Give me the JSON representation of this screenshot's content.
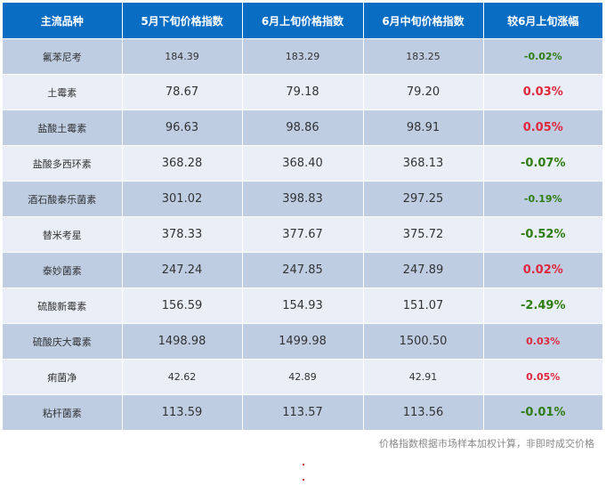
{
  "headers": [
    "主流品种",
    "5月下旬价格指数",
    "6月上旬价格指数",
    "6月中旬价格指数",
    "较6月上旬涨幅"
  ],
  "rows": [
    {
      "name": "氟苯尼考",
      "v1": "184.39",
      "v2": "183.29",
      "v3": "183.25",
      "change": "-0.02%",
      "dir": "down"
    },
    {
      "name": "土霉素",
      "v1": "78.67",
      "v2": "79.18",
      "v3": "79.20",
      "change": "0.03%",
      "dir": "up"
    },
    {
      "name": "盐酸土霉素",
      "v1": "96.63",
      "v2": "98.86",
      "v3": "98.91",
      "change": "0.05%",
      "dir": "up"
    },
    {
      "name": "盐酸多西环素",
      "v1": "368.28",
      "v2": "368.40",
      "v3": "368.13",
      "change": "-0.07%",
      "dir": "down"
    },
    {
      "name": "酒石酸泰乐菌素",
      "v1": "301.02",
      "v2": "398.83",
      "v3": "297.25",
      "change": "-0.19%",
      "dir": "down"
    },
    {
      "name": "替米考星",
      "v1": "378.33",
      "v2": "377.67",
      "v3": "375.72",
      "change": "-0.52%",
      "dir": "down"
    },
    {
      "name": "泰妙菌素",
      "v1": "247.24",
      "v2": "247.85",
      "v3": "247.89",
      "change": "0.02%",
      "dir": "up"
    },
    {
      "name": "硫酸新霉素",
      "v1": "156.59",
      "v2": "154.93",
      "v3": "151.07",
      "change": "-2.49%",
      "dir": "down"
    },
    {
      "name": "硫酸庆大霉素",
      "v1": "1498.98",
      "v2": "1499.98",
      "v3": "1500.50",
      "change": "0.03%",
      "dir": "up"
    },
    {
      "name": "痢菌净",
      "v1": "42.62",
      "v2": "42.89",
      "v3": "42.91",
      "change": "0.05%",
      "dir": "up"
    },
    {
      "name": "粘杆菌素",
      "v1": "113.59",
      "v2": "113.57",
      "v3": "113.56",
      "change": "-0.01%",
      "dir": "down"
    }
  ],
  "note": "价格指数根据市场样本加权计算，非即时成交价格",
  "colors": {
    "header_bg": "#0a6dc4",
    "row_dark": "#bfcde3",
    "row_light": "#e9eef7",
    "down": "#2e7d12",
    "up": "#e0283c"
  }
}
